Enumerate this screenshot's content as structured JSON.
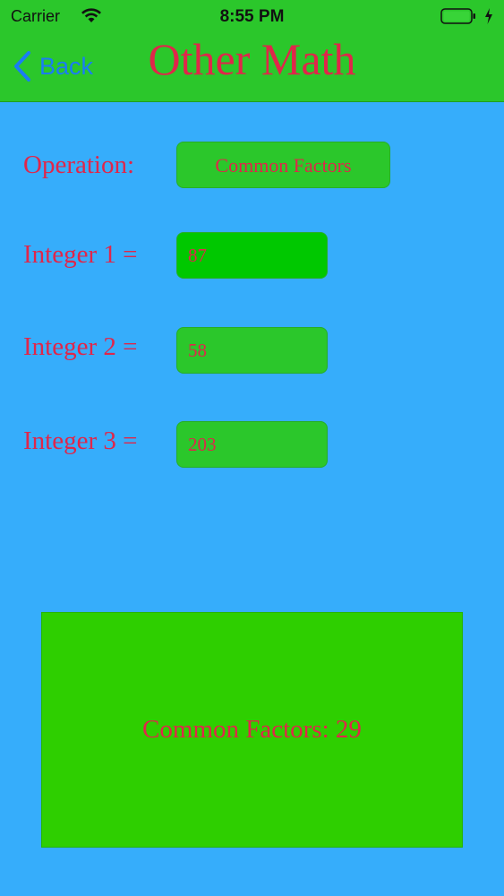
{
  "status_bar": {
    "carrier": "Carrier",
    "time": "8:55 PM"
  },
  "nav": {
    "back_label": "Back",
    "title": "Other Math"
  },
  "form": {
    "operation_label": "Operation:",
    "operation_value": "Common Factors",
    "integer1_label": "Integer 1 =",
    "integer1_value": "87",
    "integer2_label": "Integer 2 =",
    "integer2_value": "58",
    "integer3_label": "Integer 3 =",
    "integer3_value": "203"
  },
  "result": {
    "text": "Common Factors: 29"
  },
  "colors": {
    "background": "#36adfb",
    "header": "#2bc72b",
    "accent_text": "#e0264a",
    "back_link": "#1a7cf5",
    "result_box": "#2ecf00"
  },
  "icons": {
    "wifi": "wifi-icon",
    "battery": "battery-icon",
    "charging": "charging-bolt-icon",
    "back": "chevron-left-icon"
  }
}
